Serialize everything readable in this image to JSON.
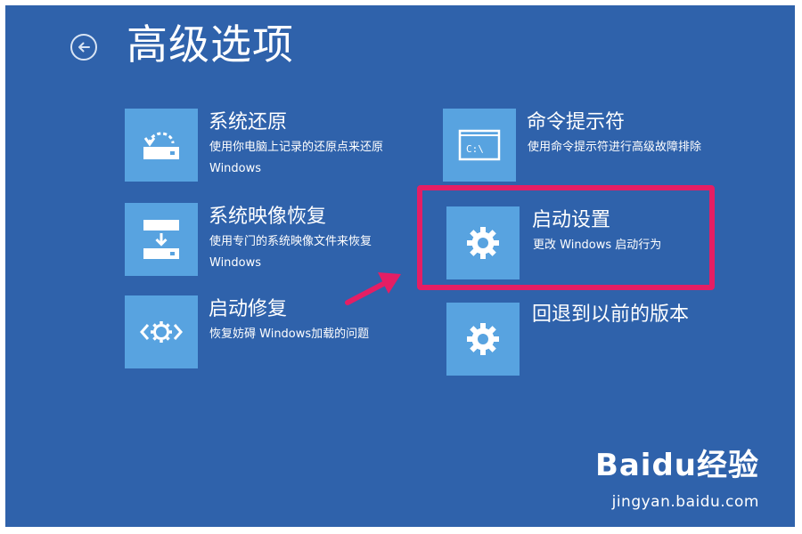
{
  "header": {
    "title": "高级选项"
  },
  "options": [
    {
      "title": "系统还原",
      "desc": "使用你电脑上记录的还原点来还原 Windows",
      "icon": "system-restore-icon"
    },
    {
      "title": "系统映像恢复",
      "desc": "使用专门的系统映像文件来恢复 Windows",
      "icon": "system-image-icon"
    },
    {
      "title": "启动修复",
      "desc": "恢复妨碍 Windows加载的问题",
      "icon": "startup-repair-icon"
    },
    {
      "title": "命令提示符",
      "desc": "使用命令提示符进行高级故障排除",
      "icon": "command-prompt-icon",
      "prompt_text": "C:\\"
    },
    {
      "title": "启动设置",
      "desc": "更改 Windows 启动行为",
      "icon": "gear-icon"
    },
    {
      "title": "回退到以前的版本",
      "desc": "",
      "icon": "gear-icon"
    }
  ],
  "watermark": {
    "brand": "Baidu经验",
    "url": "jingyan.baidu.com"
  },
  "colors": {
    "background": "#2f62ab",
    "tile": "#58a3e0",
    "highlight": "#e51e64"
  }
}
